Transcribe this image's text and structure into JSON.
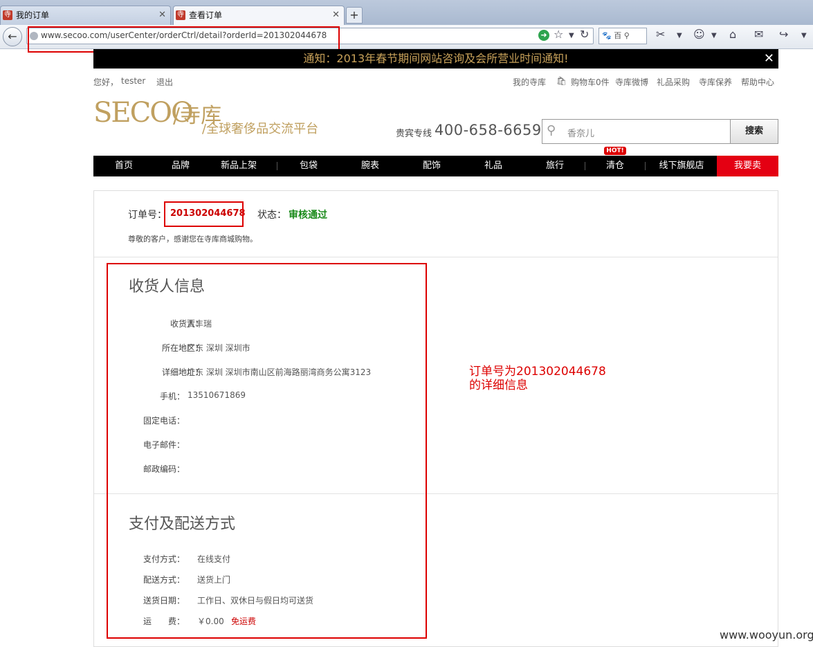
{
  "browser": {
    "tabs": [
      {
        "title": "我的订单",
        "icon": "寺"
      },
      {
        "title": "查看订单",
        "icon": "寺"
      }
    ],
    "new_tab": "+",
    "address": "www.secoo.com/userCenter/orderCtrl/detail?orderId=201302044678",
    "mini_search": "百"
  },
  "notice": {
    "text": "通知：2013年春节期间网站咨询及会所营业时间通知!",
    "close": "✕"
  },
  "topbar": {
    "greeting": "您好，",
    "username": "tester",
    "logout": "退出",
    "links": [
      "我的寺库",
      "购物车0件",
      "寺库微博",
      "礼品采购",
      "寺库保养",
      "帮助中心"
    ]
  },
  "header": {
    "logo_word": "SECOO",
    "logo_mark": "/寺库",
    "slogan": "/全球奢侈品交流平台",
    "hotline_label": "贵宾专线",
    "hotline": "400-658-6659",
    "search_placeholder": "香奈儿",
    "search_button": "搜索"
  },
  "nav": {
    "items": [
      "首页",
      "品牌",
      "新品上架",
      "包袋",
      "腕表",
      "配饰",
      "礼品",
      "旅行",
      "清仓",
      "线下旗舰店",
      "我要卖"
    ],
    "hot_badge": "HOT!"
  },
  "order": {
    "number_label": "订单号：",
    "number": "201302044678",
    "status_label": "状态：",
    "status": "审核通过",
    "thanks": "尊敬的客户，感谢您在寺库商城购物。"
  },
  "receiver": {
    "title": "收货人信息",
    "fields": [
      {
        "label": "收货人：",
        "value": "贾丰瑞"
      },
      {
        "label": "所在地区：",
        "value": "广东 深圳 深圳市"
      },
      {
        "label": "详细地址：",
        "value": "广东 深圳 深圳市南山区前海路丽湾商务公寓3123"
      },
      {
        "label": "手机：",
        "value": "13510671869"
      },
      {
        "label": "固定电话：",
        "value": ""
      },
      {
        "label": "电子邮件：",
        "value": ""
      },
      {
        "label": "邮政编码：",
        "value": ""
      }
    ]
  },
  "payment": {
    "title": "支付及配送方式",
    "fields": [
      {
        "label": "支付方式：",
        "value": "在线支付"
      },
      {
        "label": "配送方式：",
        "value": "送货上门"
      },
      {
        "label": "送货日期：",
        "value": "工作日、双休日与假日均可送货"
      },
      {
        "label": "运　　费：",
        "value": "￥0.00"
      }
    ],
    "free_shipping": "免运费"
  },
  "annotation": {
    "line1": "订单号为201302044678",
    "line2": "的详细信息"
  },
  "watermark": "www.wooyun.org",
  "colors": {
    "notice_text": "#c9a25a",
    "brand_gold": "#c0a060",
    "order_red": "#c00",
    "status_green": "#1a8a1a",
    "highlight_red": "#d00",
    "sell_bg": "#e40012"
  }
}
